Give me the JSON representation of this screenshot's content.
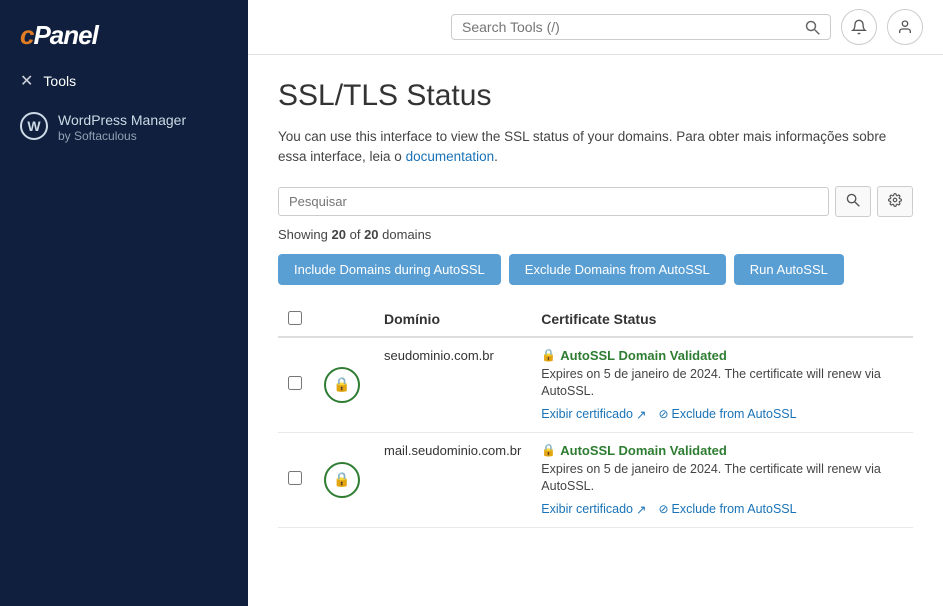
{
  "sidebar": {
    "logo": "cPanel",
    "items": [
      {
        "id": "tools",
        "label": "Tools",
        "icon": "✕"
      },
      {
        "id": "wordpress",
        "label": "WordPress Manager",
        "sublabel": "by Softaculous"
      }
    ]
  },
  "topbar": {
    "search_placeholder": "Search Tools (/)",
    "search_icon": "🔍"
  },
  "page": {
    "title": "SSL/TLS Status",
    "description_before_link": "You can use this interface to view the SSL status of your domains. Para obter mais informações sobre essa interface, leia o ",
    "link_text": "documentation",
    "description_after_link": ".",
    "search_placeholder": "Pesquisar",
    "showing_text": "Showing",
    "showing_count": "20",
    "showing_of": "of",
    "showing_total": "20",
    "showing_suffix": "domains",
    "btn_include": "Include Domains during AutoSSL",
    "btn_exclude": "Exclude Domains from AutoSSL",
    "btn_run": "Run AutoSSL",
    "table": {
      "col_domain": "Domínio",
      "col_cert": "Certificate Status",
      "rows": [
        {
          "domain": "seudominio.com.br",
          "status": "AutoSSL Domain Validated",
          "expiry": "Expires on 5 de janeiro de 2024. The certificate will renew via AutoSSL.",
          "view_cert": "Exibir certificado",
          "exclude": "Exclude from AutoSSL"
        },
        {
          "domain": "mail.seudominio.com.br",
          "status": "AutoSSL Domain Validated",
          "expiry": "Expires on 5 de janeiro de 2024. The certificate will renew via AutoSSL.",
          "view_cert": "Exibir certificado",
          "exclude": "Exclude from AutoSSL"
        }
      ]
    }
  }
}
